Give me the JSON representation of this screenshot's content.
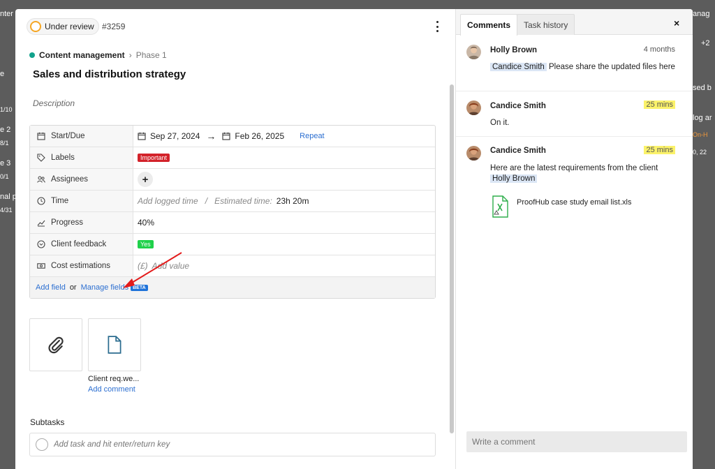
{
  "background": {
    "left_fragments": [
      "nter",
      "e",
      "1/10",
      "e 2",
      "8/1",
      "e 3",
      "0/1",
      "nal p",
      "4/31"
    ],
    "right_fragments": [
      "anag",
      "+2",
      "sed b",
      "log ar",
      "On-H",
      "0, 22"
    ]
  },
  "header": {
    "status_label": "Under review",
    "task_id": "#3259"
  },
  "breadcrumb": {
    "project": "Content management",
    "separator": "›",
    "phase": "Phase 1"
  },
  "task": {
    "title": "Sales and distribution strategy",
    "description_placeholder": "Description"
  },
  "fields": {
    "start_due": {
      "label": "Start/Due",
      "start": "Sep 27, 2024",
      "due": "Feb 26, 2025",
      "repeat_label": "Repeat"
    },
    "labels": {
      "label": "Labels",
      "value": "Important"
    },
    "assignees": {
      "label": "Assignees",
      "add": "+"
    },
    "time": {
      "label": "Time",
      "logged_placeholder": "Add logged time",
      "divider": "/",
      "estimated_label": "Estimated time:",
      "estimated_value": "23h 20m"
    },
    "progress": {
      "label": "Progress",
      "value": "40%"
    },
    "client_feedback": {
      "label": "Client feedback",
      "value": "Yes"
    },
    "cost": {
      "label": "Cost estimations",
      "currency": "(£)",
      "placeholder": "Add value"
    },
    "footer": {
      "add_field": "Add field",
      "or": "or",
      "manage_fields": "Manage fields",
      "beta": "BETA"
    }
  },
  "attachments": {
    "file_name": "Client req.we...",
    "add_comment": "Add comment"
  },
  "subtasks": {
    "heading": "Subtasks",
    "placeholder": "Add task and hit enter/return key"
  },
  "comments_panel": {
    "tabs": [
      "Comments",
      "Task history"
    ],
    "close": "×",
    "comments": [
      {
        "author": "Holly Brown",
        "time": "4 months",
        "mention": "Candice Smith",
        "text": "Please share the updated files here"
      },
      {
        "author": "Candice Smith",
        "time": "25 mins",
        "text": "On it."
      },
      {
        "author": "Candice Smith",
        "time": "25 mins",
        "text": "Here are the latest requirements from the client",
        "mention": "Holly Brown",
        "file": "ProofHub case study email list.xls"
      }
    ],
    "write_placeholder": "Write a comment"
  },
  "colors": {
    "status_ring": "#f5a623",
    "project_dot": "#12a28c",
    "important": "#d3222a",
    "yes": "#1fd14a",
    "link": "#2c6fd1",
    "highlight": "#fbf26a",
    "mention_bg": "#dbe6f5"
  }
}
